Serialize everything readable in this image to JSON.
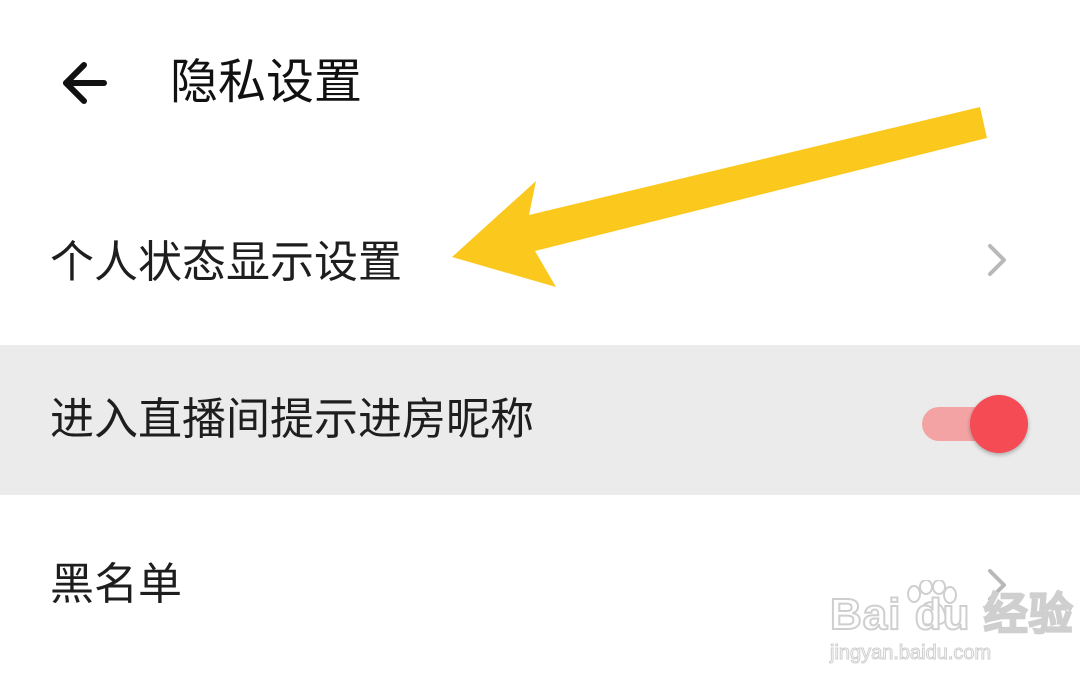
{
  "header": {
    "back_icon": "arrow-left-icon",
    "title": "隐私设置"
  },
  "settings": [
    {
      "label": "个人状态显示设置",
      "control": "chevron-right-icon",
      "highlighted": false
    },
    {
      "label": "进入直播间提示进房昵称",
      "control": "toggle",
      "toggle_on": true,
      "highlighted": true
    },
    {
      "label": "黑名单",
      "control": "chevron-right-icon",
      "highlighted": false
    }
  ],
  "colors": {
    "highlight_row_bg": "#ebebeb",
    "toggle_track": "#f3a3a3",
    "toggle_knob": "#f44b55",
    "annotation_arrow": "#fbc81e"
  },
  "annotation": {
    "icon": "yellow-arrow-annotation",
    "points_to": "个人状态显示设置"
  },
  "watermark": {
    "logo_text": "Bai du 经验",
    "url": "jingyan.baidu.com"
  }
}
